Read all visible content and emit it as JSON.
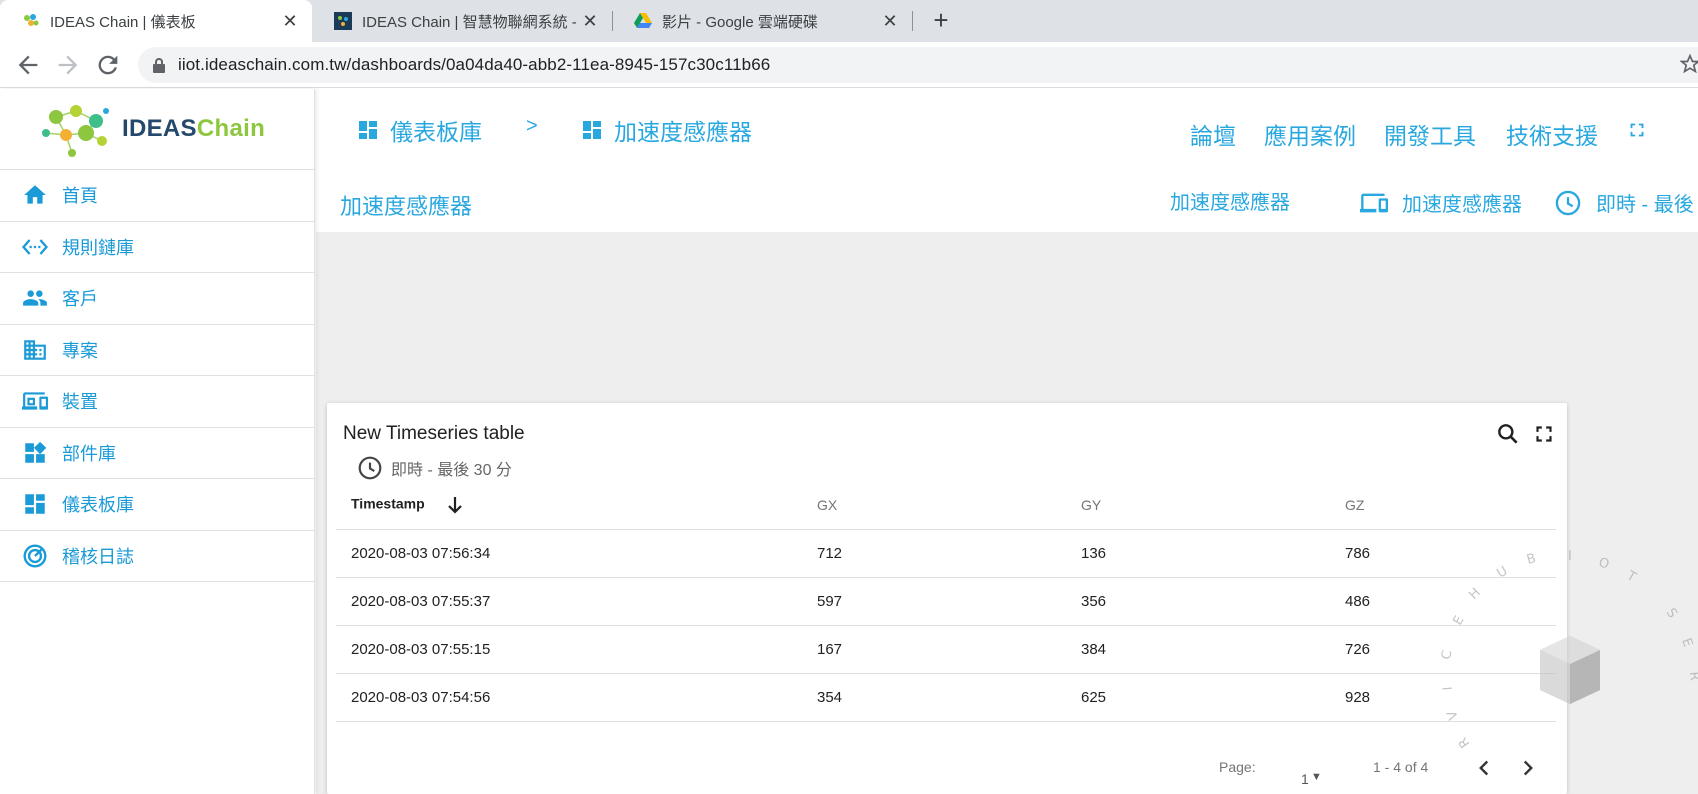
{
  "browser": {
    "tabs": [
      {
        "title": "IDEAS Chain | 儀表板",
        "close": "✕"
      },
      {
        "title": "IDEAS Chain | 智慧物聯網系統 - ",
        "close": "✕"
      },
      {
        "title": "影片 - Google 雲端硬碟",
        "close": "✕"
      }
    ],
    "new_tab": "+",
    "url": "iiot.ideaschain.com.tw/dashboards/0a04da40-abb2-11ea-8945-157c30c11b66"
  },
  "sidebar": {
    "logo": {
      "text_a": "IDEAS",
      "text_b": "Chain"
    },
    "items": [
      {
        "label": "首頁",
        "icon": "home-icon"
      },
      {
        "label": "規則鏈庫",
        "icon": "settings-ethernet-icon"
      },
      {
        "label": "客戶",
        "icon": "people-icon"
      },
      {
        "label": "專案",
        "icon": "building-icon"
      },
      {
        "label": "裝置",
        "icon": "devices-icon"
      },
      {
        "label": "部件庫",
        "icon": "widgets-icon"
      },
      {
        "label": "儀表板庫",
        "icon": "dashboard-icon"
      },
      {
        "label": "稽核日誌",
        "icon": "track-changes-icon"
      }
    ]
  },
  "header": {
    "breadcrumb": [
      {
        "label": "儀表板庫",
        "icon": "dashboard-icon"
      },
      {
        "label": "加速度感應器",
        "icon": "dashboard-icon"
      }
    ],
    "breadcrumb_sep": ">",
    "links": [
      "論壇",
      "應用案例",
      "開發工具",
      "技術支援"
    ],
    "dashboard_title": "加速度感應器",
    "state_label": "加速度感應器",
    "entity_alias": "加速度感應器",
    "timewindow": "即時 - 最後"
  },
  "widget": {
    "title": "New Timeseries table",
    "timewindow": "即時 - 最後 30 分",
    "columns": [
      "Timestamp",
      "GX",
      "GY",
      "GZ"
    ],
    "rows": [
      [
        "2020-08-03 07:56:34",
        "712",
        "136",
        "786"
      ],
      [
        "2020-08-03 07:55:37",
        "597",
        "356",
        "486"
      ],
      [
        "2020-08-03 07:55:15",
        "167",
        "384",
        "726"
      ],
      [
        "2020-08-03 07:54:56",
        "354",
        "625",
        "928"
      ]
    ],
    "pager": {
      "page_label": "Page:",
      "page": "1",
      "range": "1 - 4 of 4"
    }
  },
  "colors": {
    "accent": "#29a8e0",
    "sidebar_text": "#1a9ad6",
    "background": "#eeeeee"
  }
}
